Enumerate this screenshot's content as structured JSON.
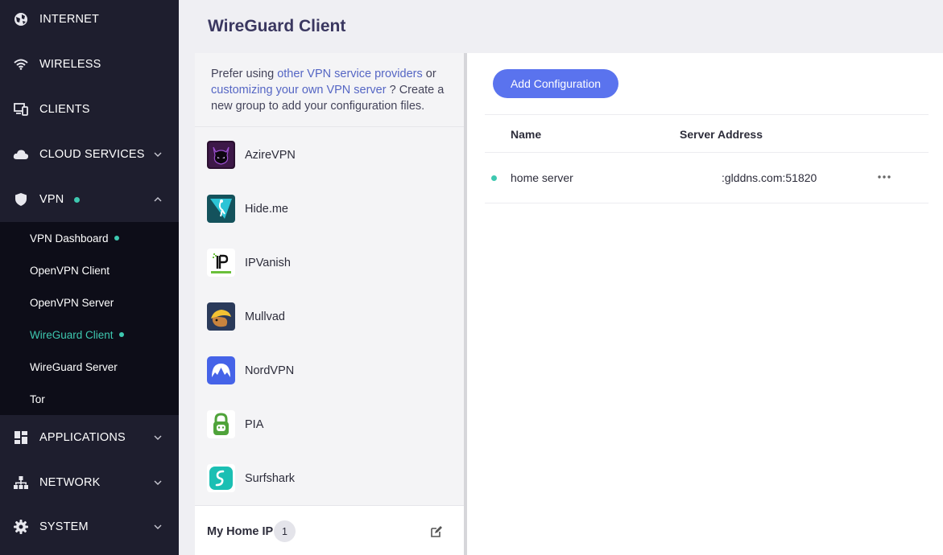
{
  "sidebar": {
    "items": [
      {
        "label": "INTERNET",
        "icon": "globe-icon"
      },
      {
        "label": "WIRELESS",
        "icon": "wifi-icon"
      },
      {
        "label": "CLIENTS",
        "icon": "devices-icon"
      },
      {
        "label": "CLOUD SERVICES",
        "icon": "cloud-icon"
      },
      {
        "label": "VPN",
        "icon": "shield-icon"
      },
      {
        "label": "APPLICATIONS",
        "icon": "apps-icon"
      },
      {
        "label": "NETWORK",
        "icon": "network-icon"
      },
      {
        "label": "SYSTEM",
        "icon": "gear-icon"
      }
    ],
    "vpn_submenu": [
      {
        "label": "VPN Dashboard",
        "status": true
      },
      {
        "label": "OpenVPN Client",
        "status": false
      },
      {
        "label": "OpenVPN Server",
        "status": false
      },
      {
        "label": "WireGuard Client",
        "status": true,
        "active": true
      },
      {
        "label": "WireGuard Server",
        "status": false
      },
      {
        "label": "Tor",
        "status": false
      }
    ]
  },
  "header": {
    "title": "WireGuard Client"
  },
  "providers": {
    "intro": {
      "prefix": "Prefer using ",
      "link1": "other VPN service providers",
      "middle": " or ",
      "link2": "customizing your own VPN server",
      "suffix": " ? Create a new group to add your configuration files."
    },
    "list": [
      {
        "name": "AzireVPN"
      },
      {
        "name": "Hide.me"
      },
      {
        "name": "IPVanish"
      },
      {
        "name": "Mullvad"
      },
      {
        "name": "NordVPN"
      },
      {
        "name": "PIA"
      },
      {
        "name": "Surfshark"
      }
    ],
    "group": {
      "name": "My Home IP",
      "count": "1"
    }
  },
  "configs": {
    "add_label": "Add Configuration",
    "columns": {
      "name": "Name",
      "server": "Server Address"
    },
    "rows": [
      {
        "name": "home server",
        "server": ":glddns.com:51820"
      }
    ]
  },
  "colors": {
    "accent": "#5a73ee",
    "status": "#3ec8b0",
    "sidebar": "#1e1e2e",
    "submenu": "#0d0d18"
  }
}
